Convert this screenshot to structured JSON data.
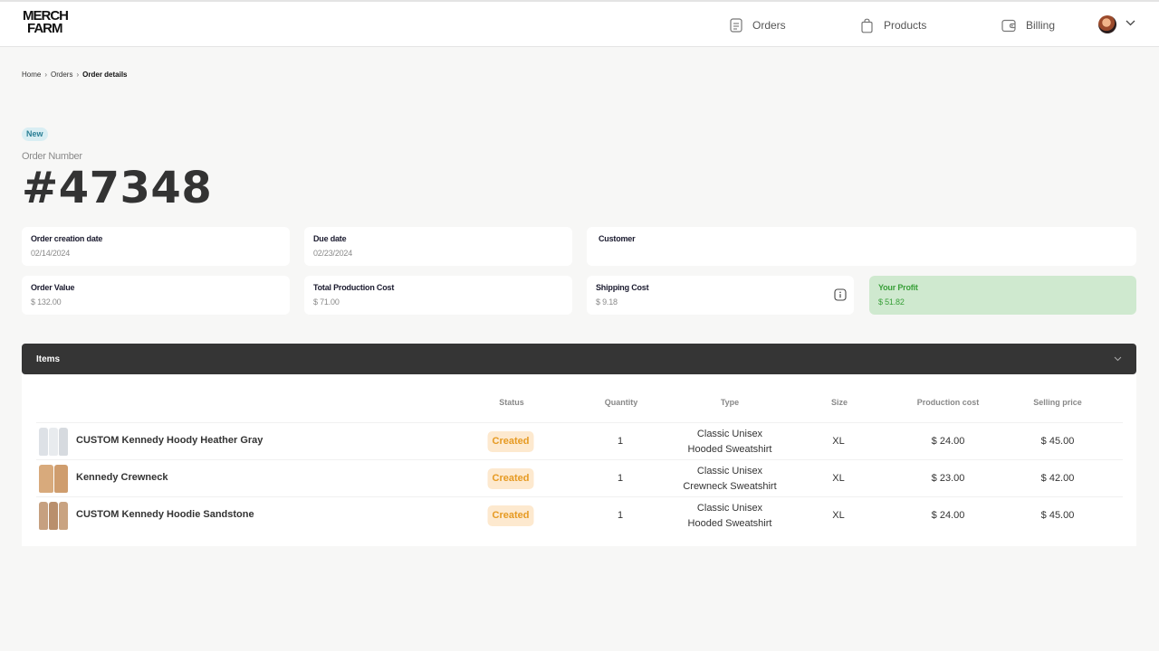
{
  "header": {
    "logo_line1": "MERCH",
    "logo_line2": "FARM",
    "nav": [
      {
        "label": "Orders",
        "icon": "document-icon"
      },
      {
        "label": "Products",
        "icon": "shopping-bag-icon"
      },
      {
        "label": "Billing",
        "icon": "wallet-icon"
      }
    ]
  },
  "breadcrumb": [
    "Home",
    "Orders",
    "Order details"
  ],
  "order": {
    "badge": "New",
    "number_label": "Order Number",
    "number": "#47348"
  },
  "cards": {
    "creation_date": {
      "title": "Order creation date",
      "value": "02/14/2024"
    },
    "due_date": {
      "title": "Due date",
      "value": "02/23/2024"
    },
    "customer": {
      "title": "Customer",
      "value": ""
    },
    "order_value": {
      "title": "Order Value",
      "value": "$ 132.00"
    },
    "production_cost": {
      "title": "Total Production Cost",
      "value": "$ 71.00"
    },
    "shipping_cost": {
      "title": "Shipping Cost",
      "value": "$ 9.18"
    },
    "profit": {
      "title": "Your Profit",
      "value": "$ 51.82"
    }
  },
  "items": {
    "title": "Items",
    "columns": {
      "status": "Status",
      "quantity": "Quantity",
      "type": "Type",
      "size": "Size",
      "production_cost": "Production cost",
      "selling_price": "Selling price"
    },
    "rows": [
      {
        "name": "CUSTOM Kennedy Hoody Heather Gray",
        "status": "Created",
        "quantity": "1",
        "type_line1": "Classic Unisex",
        "type_line2": "Hooded Sweatshirt",
        "size": "XL",
        "production_cost": "$ 24.00",
        "selling_price": "$ 45.00"
      },
      {
        "name": "Kennedy Crewneck",
        "status": "Created",
        "quantity": "1",
        "type_line1": "Classic Unisex",
        "type_line2": "Crewneck Sweatshirt",
        "size": "XL",
        "production_cost": "$ 23.00",
        "selling_price": "$ 42.00"
      },
      {
        "name": "CUSTOM Kennedy Hoodie Sandstone",
        "status": "Created",
        "quantity": "1",
        "type_line1": "Classic Unisex",
        "type_line2": "Hooded Sweatshirt",
        "size": "XL",
        "production_cost": "$ 24.00",
        "selling_price": "$ 45.00"
      }
    ]
  },
  "colors": {
    "profit_bg": "#cfe9cf",
    "profit_text": "#3aa03a",
    "status_bg": "#fde9cf",
    "status_text": "#e69a22",
    "badge_bg": "#d9eef3",
    "items_bar": "#353535"
  }
}
